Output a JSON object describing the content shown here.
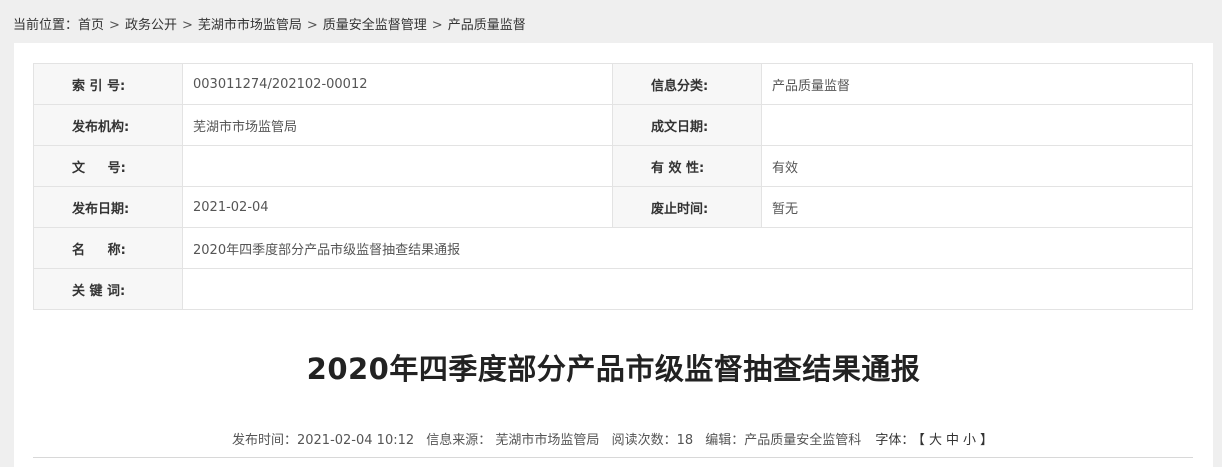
{
  "breadcrumb": {
    "prefix": "当前位置：",
    "items": [
      "首页",
      "政务公开",
      "芜湖市市场监管局",
      "质量安全监督管理",
      "产品质量监督"
    ],
    "separator": ">"
  },
  "meta": {
    "index_label": "索 引 号:",
    "index_value": "003011274/202102-00012",
    "category_label": "信息分类:",
    "category_value": "产品质量监督",
    "publisher_label": "发布机构:",
    "publisher_value": "芜湖市市场监管局",
    "written_date_label": "成文日期:",
    "written_date_value": "",
    "doc_no_label": "文     号:",
    "doc_no_value": "",
    "validity_label": "有 效 性:",
    "validity_value": "有效",
    "pub_date_label": "发布日期:",
    "pub_date_value": "2021-02-04",
    "expiry_label": "废止时间:",
    "expiry_value": "暂无",
    "name_label": "名     称:",
    "name_value": "2020年四季度部分产品市级监督抽查结果通报",
    "keywords_label": "关 键 词:",
    "keywords_value": ""
  },
  "article": {
    "title": "2020年四季度部分产品市级监督抽查结果通报",
    "publish_time": "发布时间：2021-02-04 10:12",
    "source": "信息来源：  芜湖市市场监管局",
    "views": "阅读次数：18",
    "editor": "编辑：产品质量安全监管科",
    "font_label": "字体：",
    "font_open": "【",
    "font_large": "大",
    "font_medium": "中",
    "font_small": "小",
    "font_close": "】"
  }
}
